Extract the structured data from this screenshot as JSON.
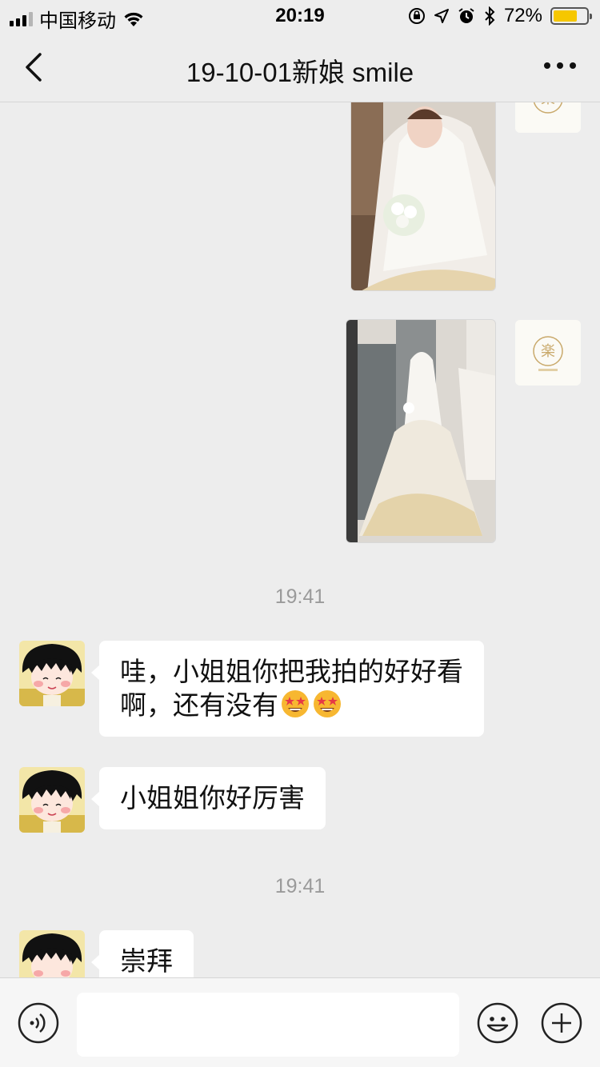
{
  "status_bar": {
    "carrier": "中国移动",
    "time": "20:19",
    "battery": "72%",
    "battery_level": 0.72,
    "icons": [
      "signal-icon",
      "wifi-icon",
      "orientation-lock-icon",
      "location-icon",
      "alarm-icon",
      "bluetooth-icon",
      "battery-icon"
    ]
  },
  "nav": {
    "title": "19-10-01新娘 smile",
    "back_icon": "chevron-left-icon",
    "more_icon": "more-icon"
  },
  "messages": {
    "timestamp_1": "19:41",
    "msg_1_line1": "哇，小姐姐你把我拍的好好看",
    "msg_1_line2": "啊，还有没有",
    "msg_2": "小姐姐你好厉害",
    "timestamp_2": "19:41",
    "msg_3": "崇拜"
  },
  "input_bar": {
    "voice_icon": "voice-icon",
    "input_value": "",
    "emoji_icon": "emoji-icon",
    "plus_icon": "plus-icon"
  },
  "colors": {
    "background": "#ededed",
    "bubble": "#ffffff",
    "battery_fill": "#f6c700",
    "timestamp": "#9a9a9a"
  }
}
